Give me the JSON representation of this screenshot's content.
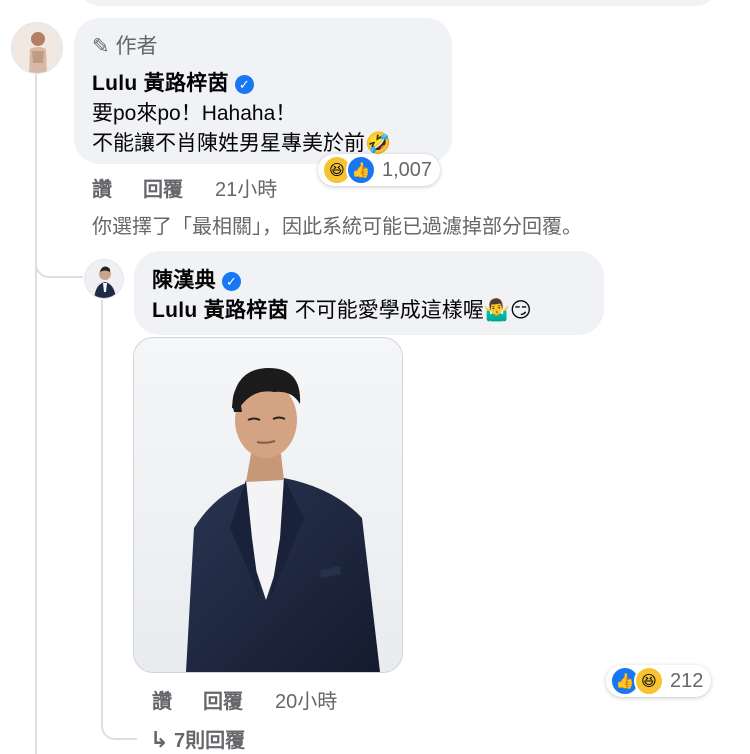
{
  "comments": [
    {
      "author_tag": "作者",
      "name": "Lulu 黃路梓茵",
      "text_lines": [
        "要po來po！Hahaha！",
        "不能讓不肖陳姓男星專美於前🤣"
      ],
      "reactions": [
        "haha",
        "like"
      ],
      "reaction_count": "1,007",
      "like_label": "讚",
      "reply_label": "回覆",
      "time": "21小時"
    }
  ],
  "filter_notice": "你選擇了「最相關」，因此系統可能已過濾掉部分回覆。",
  "reply": {
    "name": "陳漢典",
    "mention": "Lulu 黃路梓茵",
    "text": " 不可能愛學成這樣喔🤷‍♂️😏",
    "reactions": [
      "like",
      "haha"
    ],
    "reaction_count": "212",
    "like_label": "讚",
    "reply_label": "回覆",
    "time": "20小時"
  },
  "more_replies": "7則回覆",
  "colors": {
    "bubble": "#f0f2f5",
    "secondary_text": "#65676b",
    "verified": "#1877f2",
    "thread_line": "#dcdfe4"
  },
  "icons": {
    "author_tag": "pencil-icon",
    "verified": "check-badge-icon",
    "more_replies": "reply-arrow-icon"
  }
}
